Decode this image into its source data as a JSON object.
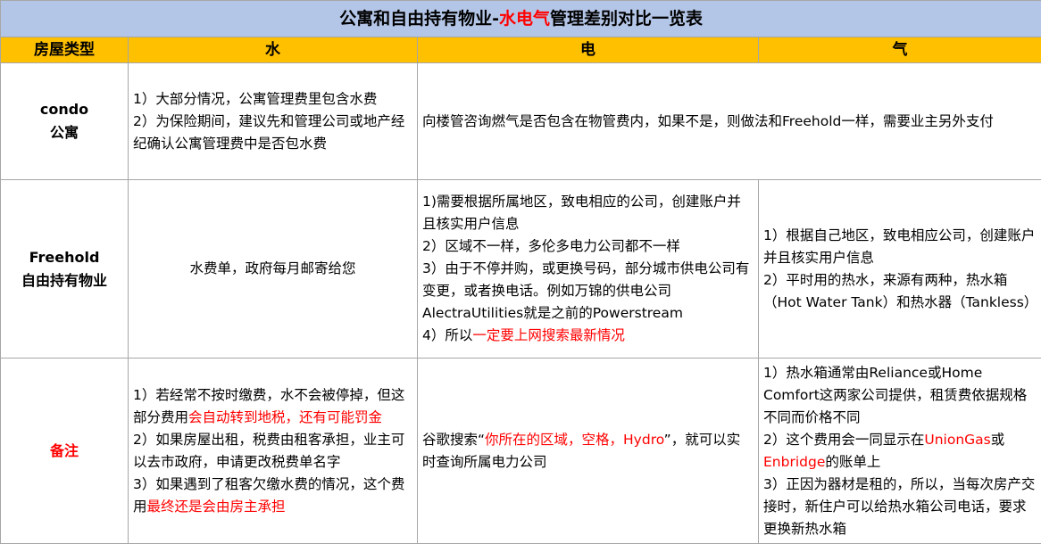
{
  "title": {
    "prefix": "公寓和自由持有物业-",
    "highlight": "水电气",
    "suffix": "管理差别对比一览表"
  },
  "colors": {
    "title_bg": "#b4c6e7",
    "header_bg": "#ffc000",
    "emphasis": "#ff0000",
    "grid": "#a6a6a6"
  },
  "header": {
    "type": "房屋类型",
    "water": "水",
    "electric": "电",
    "gas": "气"
  },
  "condo": {
    "label_en": "condo",
    "label_cn": "公寓",
    "water": {
      "p1": "1）大部分情况，公寓管理费里包含水费",
      "p2": "2）为保险期间，建议先和管理公司或地产经纪确认公寓管理费中是否包水费"
    },
    "electric_gas": "向楼管咨询燃气是否包含在物管费内，如果不是，则做法和Freehold一样，需要业主另外支付"
  },
  "freehold": {
    "label_en": "Freehold",
    "label_cn": "自由持有物业",
    "water": "水费单，政府每月邮寄给您",
    "electric": {
      "p1": "1)需要根据所属地区，致电相应的公司，创建账户并且核实用户信息",
      "p2": "2）区域不一样，多伦多电力公司都不一样",
      "p3": "3）由于不停并购，或更换号码，部分城市供电公司有变更，或者换电话。例如万锦的供电公司AlectraUtilities就是之前的Powerstream",
      "p4_prefix": "4）所以",
      "p4_highlight": "一定要上网搜索最新情况"
    },
    "gas": {
      "p1": "1）根据自己地区，致电相应公司，创建账户并且核实用户信息",
      "p2": "2）平时用的热水，来源有两种，热水箱（Hot Water Tank）和热水器（Tankless）"
    }
  },
  "notes": {
    "label": "备注",
    "water": {
      "p1_prefix": "1）若经常不按时缴费，水不会被停掉，但这部分费用",
      "p1_highlight": "会自动转到地税，还有可能罚金",
      "p2": "2）如果房屋出租，税费由租客承担，业主可以去市政府，申请更改税费单名字",
      "p3_prefix": "3）如果遇到了租客欠缴水费的情况，这个费用",
      "p3_highlight": "最终还是会由房主承担"
    },
    "electric": {
      "prefix": "谷歌搜索“",
      "highlight": "你所在的区域，空格，Hydro",
      "suffix": "”，就可以实时查询所属电力公司"
    },
    "gas": {
      "p1": "1）热水箱通常由Reliance或Home Comfort这两家公司提供，租赁费依据规格不同而价格不同",
      "p2_prefix": "2）这个费用会一同显示在",
      "p2_hl1": "UnionGas",
      "p2_mid": "或",
      "p2_hl2": "Enbridge",
      "p2_suffix": "的账单上",
      "p3": "3）正因为器材是租的，所以，当每次房产交接时，新住户可以给热水箱公司电话，要求更换新热水箱"
    }
  }
}
